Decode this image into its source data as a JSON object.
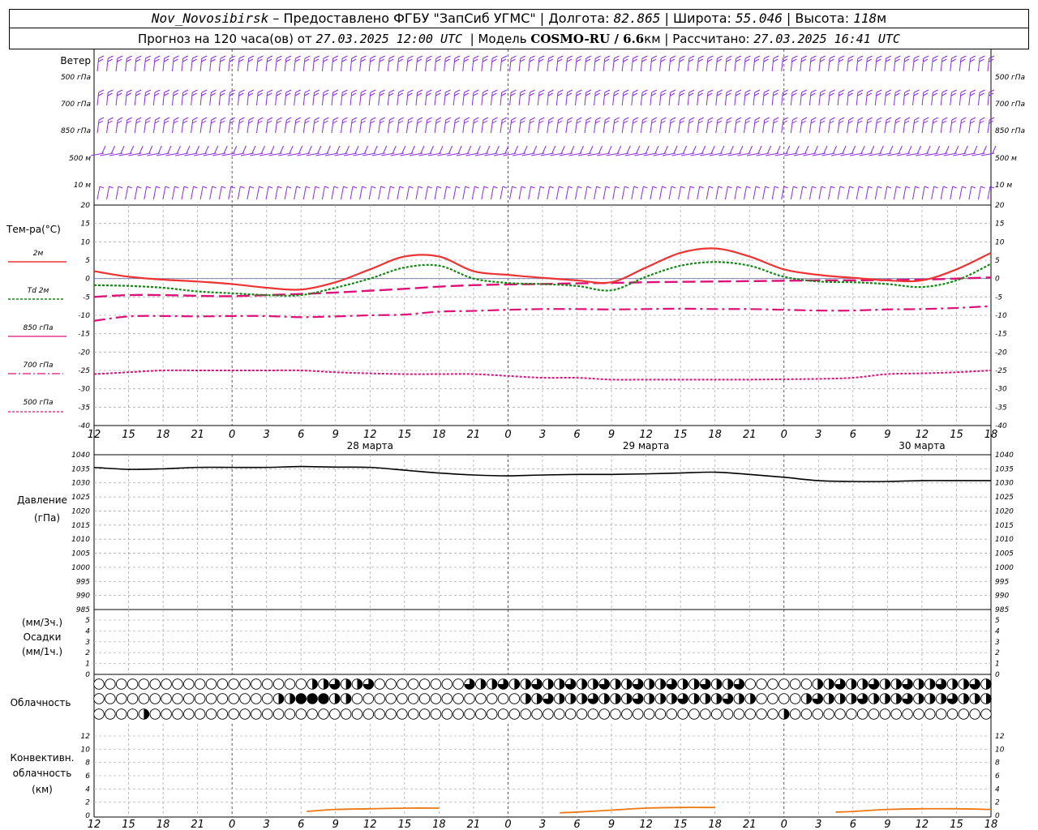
{
  "header": {
    "station": "Nov_Novosibirsk",
    "dash": " – ",
    "provided": "Предоставлено ФГБУ \"ЗапСиб УГМС\"",
    "lon_label": "Долгота:",
    "lon": "82.865",
    "lat_label": "Широта:",
    "lat": "55.046",
    "alt_label": "Высота:",
    "alt": "118",
    "alt_unit": "м",
    "forecast_label": "Прогноз на 120 часа(ов) от",
    "forecast_time": "27.03.2025 12:00 UTC",
    "model_label": "Модель",
    "model": "COSMO-RU / 6.6",
    "model_unit": "км",
    "calc_label": "Рассчитано:",
    "calc_time": "27.03.2025 16:41 UTC"
  },
  "wind_panel": {
    "title": "Ветер",
    "levels": [
      "500 гПа",
      "700 гПа",
      "850 гПа",
      "500 м",
      "10  м"
    ]
  },
  "temp_panel": {
    "title": "Тем-ра(°C)",
    "legend": [
      {
        "label": "2м",
        "color": "#ee3333",
        "style": "solid"
      },
      {
        "label": "Td  2м",
        "color": "#118811",
        "style": "dotted"
      },
      {
        "label": "850 гПа",
        "color": "#dd1177",
        "style": "dash"
      },
      {
        "label": "700 гПа",
        "color": "#dd1177",
        "style": "dashdot"
      },
      {
        "label": "500 гПа",
        "color": "#dd1177",
        "style": "dot"
      }
    ],
    "y_ticks": [
      "20",
      "15",
      "10",
      "5",
      "0",
      "-5",
      "-10",
      "-15",
      "-20",
      "-25",
      "-30",
      "-35",
      "-40"
    ]
  },
  "pressure_panel": {
    "title1": "Давление",
    "title2": "(гПа)",
    "y_ticks": [
      "1040",
      "1035",
      "1030",
      "1025",
      "1020",
      "1015",
      "1010",
      "1005",
      "1000",
      "995",
      "990",
      "985"
    ]
  },
  "precip_panel": {
    "title1": "(мм/3ч.)",
    "title2": "Осадки",
    "title3": "(мм/1ч.)",
    "y_ticks": [
      "5",
      "4",
      "3",
      "2",
      "1",
      "0"
    ]
  },
  "cloud_panel": {
    "title": "Облачность"
  },
  "conv_panel": {
    "title1": "Конвективн.",
    "title2": "облачность",
    "title3": "(км)",
    "y_ticks": [
      "12",
      "10",
      "8",
      "6",
      "4",
      "2",
      "0"
    ]
  },
  "x_axis": {
    "hour_labels": [
      "12",
      "15",
      "18",
      "21",
      "0",
      "3",
      "6",
      "9",
      "12",
      "15",
      "18",
      "21",
      "0",
      "3",
      "6",
      "9",
      "12",
      "15",
      "18",
      "21",
      "0",
      "3",
      "6",
      "9",
      "12",
      "15",
      "18"
    ],
    "dates": [
      "28 марта",
      "29 марта",
      "30 марта"
    ]
  },
  "chart_data": [
    {
      "type": "line",
      "title": "Тем-ра(°C)",
      "x": [
        0,
        3,
        6,
        9,
        12,
        15,
        18,
        21,
        24,
        27,
        30,
        33,
        36,
        39,
        42,
        45,
        48,
        51,
        54,
        57,
        60,
        63,
        66,
        69,
        72,
        75,
        78
      ],
      "ylim": [
        -40,
        20
      ],
      "series": [
        {
          "name": "2м",
          "values": [
            2,
            0.5,
            -0.3,
            -0.8,
            -1.5,
            -2.5,
            -3,
            -1,
            2.5,
            6,
            6,
            2,
            1,
            0.2,
            -0.5,
            -1,
            3,
            7,
            8.2,
            6,
            2.5,
            1,
            0.2,
            -0.5,
            -0.5,
            2.5,
            7
          ]
        },
        {
          "name": "Td  2м",
          "values": [
            -1.8,
            -2,
            -2.5,
            -3.5,
            -4,
            -4.5,
            -4.5,
            -2.5,
            0,
            3,
            3.5,
            0,
            -1.2,
            -1.5,
            -2,
            -3.2,
            0.5,
            3.5,
            4.5,
            3.5,
            0.5,
            -0.8,
            -1,
            -1.5,
            -2.3,
            -0.5,
            4
          ]
        },
        {
          "name": "850 гПа",
          "values": [
            -5,
            -4.5,
            -4.5,
            -4.7,
            -4.8,
            -4.5,
            -4.2,
            -3.8,
            -3.3,
            -2.8,
            -2.2,
            -1.8,
            -1.6,
            -1.5,
            -1.3,
            -1.2,
            -1,
            -0.9,
            -0.8,
            -0.7,
            -0.6,
            -0.5,
            -0.5,
            -0.4,
            -0.3,
            0,
            0.3
          ]
        },
        {
          "name": "700 гПа",
          "values": [
            -11.5,
            -10.3,
            -10.2,
            -10.3,
            -10.2,
            -10.2,
            -10.5,
            -10.3,
            -10,
            -9.8,
            -9,
            -8.8,
            -8.5,
            -8.3,
            -8.3,
            -8.4,
            -8.3,
            -8.2,
            -8.3,
            -8.3,
            -8.5,
            -8.7,
            -8.7,
            -8.4,
            -8.3,
            -8,
            -7.5
          ]
        },
        {
          "name": "500 гПа",
          "values": [
            -26,
            -25.5,
            -25,
            -25,
            -25,
            -25,
            -25,
            -25.5,
            -25.8,
            -26,
            -26,
            -26,
            -26.5,
            -27,
            -27,
            -27.5,
            -27.5,
            -27.5,
            -27.5,
            -27.5,
            -27.4,
            -27.3,
            -27,
            -26,
            -25.8,
            -25.5,
            -25
          ]
        }
      ]
    },
    {
      "type": "line",
      "title": "Давление (гПа)",
      "x": [
        0,
        3,
        6,
        9,
        12,
        15,
        18,
        21,
        24,
        27,
        30,
        33,
        36,
        39,
        42,
        45,
        48,
        51,
        54,
        57,
        60,
        63,
        66,
        69,
        72,
        75,
        78
      ],
      "ylim": [
        985,
        1040
      ],
      "series": [
        {
          "name": "",
          "values": [
            1035.5,
            1034.8,
            1035,
            1035.5,
            1035.5,
            1035.5,
            1035.8,
            1035.6,
            1035.5,
            1034.5,
            1033.5,
            1032.8,
            1032.5,
            1032.8,
            1033,
            1033,
            1033.2,
            1033.5,
            1033.8,
            1033,
            1032,
            1030.8,
            1030.5,
            1030.5,
            1030.8,
            1030.8,
            1030.8
          ]
        }
      ]
    },
    {
      "type": "line",
      "title": "Конвективн. облачность (км)",
      "ylim": [
        0,
        13
      ],
      "series": [
        {
          "name": "",
          "x": [
            18.5,
            21,
            24,
            27,
            30
          ],
          "values": [
            0.6,
            0.9,
            1.0,
            1.1,
            1.1
          ]
        },
        {
          "name": "",
          "x": [
            40.5,
            42,
            45,
            48,
            51,
            54
          ],
          "values": [
            0.4,
            0.5,
            0.8,
            1.1,
            1.2,
            1.2
          ]
        },
        {
          "name": "",
          "x": [
            64.5,
            66,
            69,
            72,
            75,
            78
          ],
          "values": [
            0.5,
            0.6,
            0.9,
            1.0,
            1.0,
            0.9
          ]
        }
      ]
    }
  ]
}
